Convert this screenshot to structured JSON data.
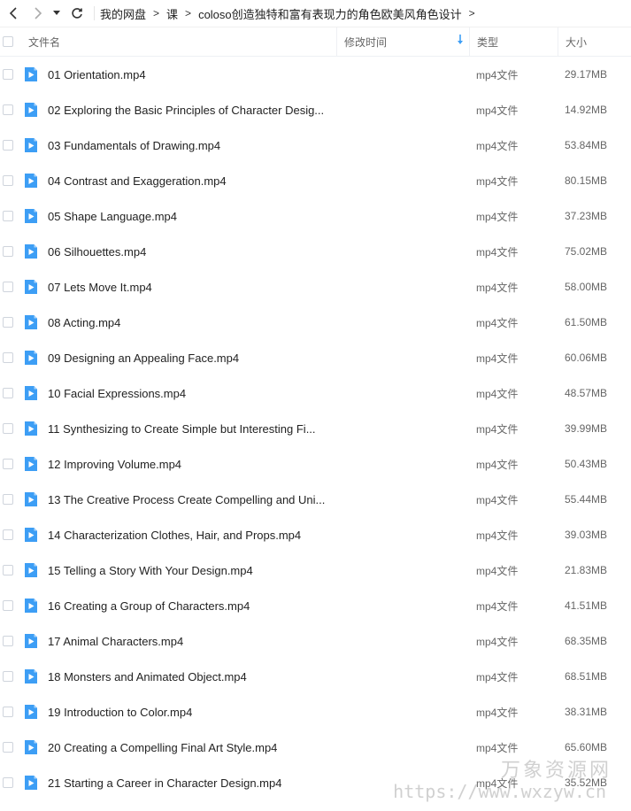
{
  "nav": {
    "back_icon": "chevron-left-icon",
    "forward_icon": "chevron-right-icon",
    "history_icon": "dropdown-triangle-icon",
    "refresh_icon": "refresh-icon",
    "breadcrumb": [
      "我的网盘",
      "课",
      "coloso创造独特和富有表现力的角色欧美风角色设计"
    ]
  },
  "columns": {
    "name": "文件名",
    "modified": "修改时间",
    "type": "类型",
    "size": "大小",
    "sort_icon": "arrow-down-icon"
  },
  "colors": {
    "accent": "#3d9ef5",
    "sort": "#3d9ef5"
  },
  "files": [
    {
      "name": "01 Orientation.mp4",
      "type": "mp4文件",
      "size": "29.17MB"
    },
    {
      "name": "02 Exploring the Basic Principles of Character Desig...",
      "type": "mp4文件",
      "size": "14.92MB"
    },
    {
      "name": "03 Fundamentals of Drawing.mp4",
      "type": "mp4文件",
      "size": "53.84MB"
    },
    {
      "name": "04 Contrast and Exaggeration.mp4",
      "type": "mp4文件",
      "size": "80.15MB"
    },
    {
      "name": "05 Shape Language.mp4",
      "type": "mp4文件",
      "size": "37.23MB"
    },
    {
      "name": "06 Silhouettes.mp4",
      "type": "mp4文件",
      "size": "75.02MB"
    },
    {
      "name": "07 Lets Move It.mp4",
      "type": "mp4文件",
      "size": "58.00MB"
    },
    {
      "name": "08 Acting.mp4",
      "type": "mp4文件",
      "size": "61.50MB"
    },
    {
      "name": "09 Designing an Appealing Face.mp4",
      "type": "mp4文件",
      "size": "60.06MB"
    },
    {
      "name": "10 Facial Expressions.mp4",
      "type": "mp4文件",
      "size": "48.57MB"
    },
    {
      "name": "11 Synthesizing to Create Simple but Interesting Fi...",
      "type": "mp4文件",
      "size": "39.99MB"
    },
    {
      "name": "12 Improving Volume.mp4",
      "type": "mp4文件",
      "size": "50.43MB"
    },
    {
      "name": "13 The Creative Process Create Compelling and Uni...",
      "type": "mp4文件",
      "size": "55.44MB"
    },
    {
      "name": "14 Characterization Clothes, Hair, and Props.mp4",
      "type": "mp4文件",
      "size": "39.03MB"
    },
    {
      "name": "15 Telling a Story With Your Design.mp4",
      "type": "mp4文件",
      "size": "21.83MB"
    },
    {
      "name": "16 Creating a Group of Characters.mp4",
      "type": "mp4文件",
      "size": "41.51MB"
    },
    {
      "name": "17 Animal Characters.mp4",
      "type": "mp4文件",
      "size": "68.35MB"
    },
    {
      "name": "18 Monsters and Animated Object.mp4",
      "type": "mp4文件",
      "size": "68.51MB"
    },
    {
      "name": "19 Introduction to Color.mp4",
      "type": "mp4文件",
      "size": "38.31MB"
    },
    {
      "name": "20 Creating a Compelling Final Art Style.mp4",
      "type": "mp4文件",
      "size": "65.60MB"
    },
    {
      "name": "21 Starting a Career in Character Design.mp4",
      "type": "mp4文件",
      "size": "35.52MB"
    }
  ],
  "watermark": {
    "title": "万象资源网",
    "url": "https://www.wxzyw.cn"
  }
}
